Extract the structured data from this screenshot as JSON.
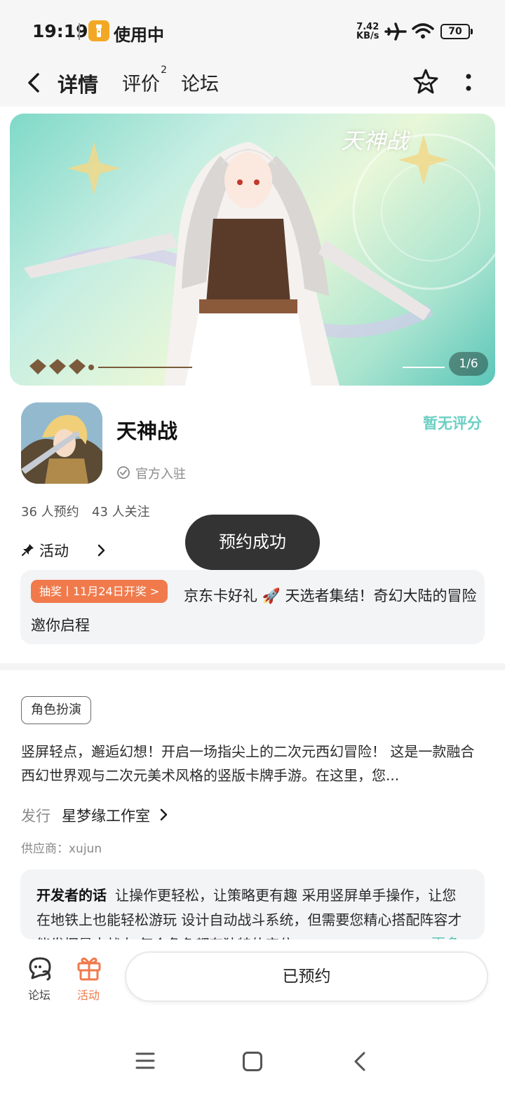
{
  "status_bar": {
    "time": "19:19",
    "in_use_label": "使用中",
    "speed_value": "7.42",
    "speed_unit": "KB/s",
    "battery": "70"
  },
  "nav": {
    "tabs": [
      {
        "label": "详情",
        "active": true
      },
      {
        "label": "评价",
        "badge": "2"
      },
      {
        "label": "论坛"
      }
    ]
  },
  "banner": {
    "logo_text": "天神战",
    "counter": "1/6"
  },
  "app": {
    "title": "天神战",
    "official_label": "官方入驻",
    "rating_text": "暂无评分"
  },
  "stats": {
    "reservations": "36 人预约",
    "followers": "43 人关注"
  },
  "activity": {
    "section_label": "活动",
    "badge": "抽奖丨11月24日开奖 >",
    "text": "京东卡好礼 🚀 天选者集结！奇幻大陆的冒险邀你启程"
  },
  "toast": "预约成功",
  "genre_tag": "角色扮演",
  "description": "竖屏轻点，邂逅幻想！开启一场指尖上的二次元西幻冒险！ 这是一款融合西幻世界观与二次元美术风格的竖版卡牌手游。在这里，您...",
  "publisher": {
    "label": "发行",
    "name": "星梦缘工作室"
  },
  "supplier": "供应商：xujun",
  "developer_note": {
    "title": "开发者的话",
    "text": "让操作更轻松，让策略更有趣 采用竖屏单手操作，让您在地铁上也能轻松游玩 设计自动战斗系统，但需要您精心搭配阵容才能发挥最大战力 每个角色都有独特的定位",
    "more_label": "更多"
  },
  "bottom_bar": {
    "forum_label": "论坛",
    "activity_label": "活动",
    "reserved_button": "已预约"
  },
  "colors": {
    "accent_teal": "#3ec6ba",
    "rating_teal": "#6bcfc3",
    "orange": "#f07a4c",
    "toast_bg": "#333333"
  },
  "icons": [
    "back-arrow-icon",
    "star-icon",
    "more-icon",
    "shield-check-icon",
    "pin-icon",
    "chevron-right-icon",
    "forum-chat-icon",
    "gift-icon",
    "menu-lines-icon",
    "home-square-icon",
    "back-chevron-icon",
    "airplane-icon",
    "wifi-icon",
    "torch-icon"
  ]
}
